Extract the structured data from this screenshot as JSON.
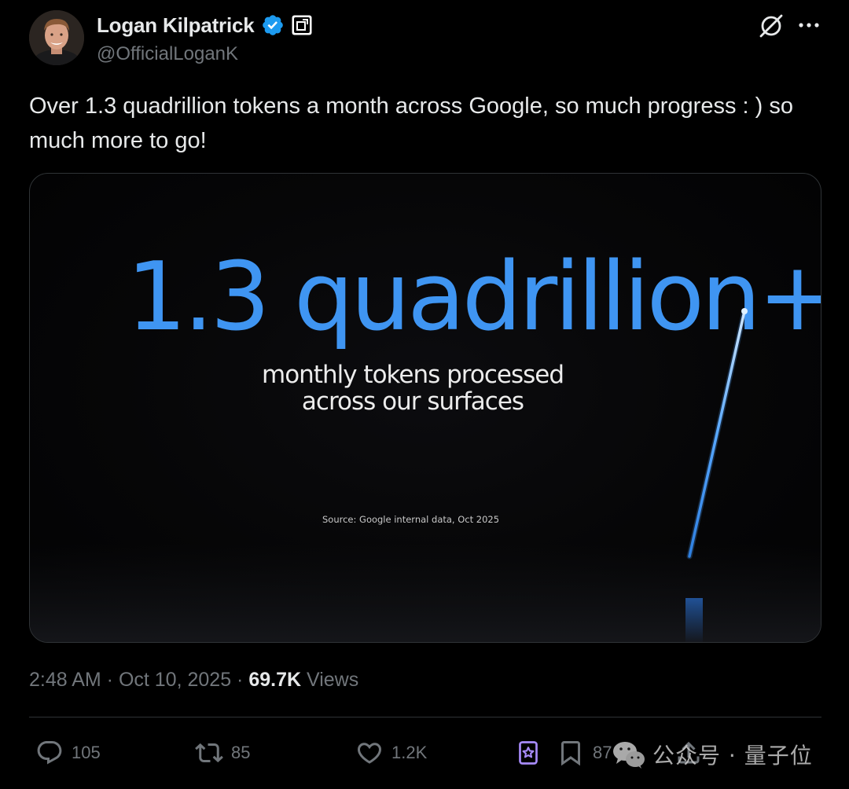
{
  "author": {
    "display_name": "Logan Kilpatrick",
    "handle": "@OfficialLoganK",
    "verified": true
  },
  "post": {
    "text": "Over 1.3 quadrillion tokens a month across Google, so much progress : ) so much more to go!",
    "timestamp": "2:48 AM · Oct 10, 2025 · ",
    "views_count": "69.7K",
    "views_label": " Views"
  },
  "media": {
    "headline": "1.3 quadrillion+",
    "subline_1": "monthly tokens processed",
    "subline_2": "across our surfaces",
    "source": "Source: Google internal data, Oct 2025"
  },
  "actions": {
    "replies": "105",
    "reposts": "85",
    "likes": "1.2K",
    "bookmarks": "87"
  },
  "watermark": {
    "text": "公众号 · 量子位"
  },
  "icons": {
    "verified": "verified-badge-icon",
    "affiliate": "affiliate-badge-icon",
    "grok": "grok-icon",
    "more": "more-icon",
    "reply": "reply-icon",
    "repost": "repost-icon",
    "like": "like-icon",
    "grok_action": "grok-action-icon",
    "bookmark": "bookmark-icon",
    "share": "share-icon",
    "wechat": "wechat-icon"
  },
  "colors": {
    "background": "#000000",
    "text_primary": "#e7e9ea",
    "text_secondary": "#71767b",
    "verified_blue": "#1d9bf0",
    "slide_blue": "#3f95f2",
    "grok_purple": "#a78bfa"
  }
}
